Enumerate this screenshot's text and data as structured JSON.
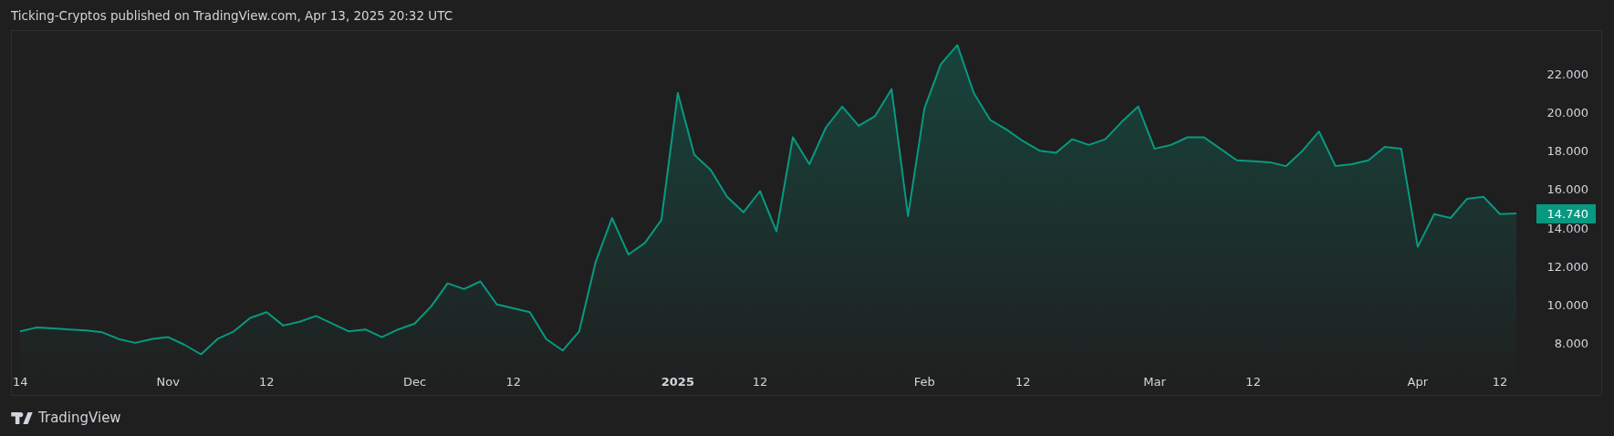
{
  "header": "Ticking-Cryptos published on TradingView.com, Apr 13, 2025 20:32 UTC",
  "chart": {
    "last_price": "14.740",
    "chart_data": {
      "type": "area",
      "categories": [
        "14",
        null,
        null,
        null,
        null,
        null,
        null,
        null,
        null,
        "Nov",
        null,
        null,
        null,
        null,
        null,
        "12",
        null,
        null,
        null,
        null,
        null,
        null,
        null,
        null,
        "Dec",
        null,
        null,
        null,
        null,
        null,
        "12",
        null,
        null,
        null,
        null,
        null,
        null,
        null,
        null,
        null,
        "**2025**",
        null,
        null,
        null,
        null,
        "12",
        null,
        null,
        null,
        null,
        null,
        null,
        null,
        null,
        null,
        "Feb",
        null,
        null,
        null,
        null,
        null,
        "12",
        null,
        null,
        null,
        null,
        null,
        null,
        null,
        "Mar",
        null,
        null,
        null,
        null,
        null,
        "12",
        null,
        null,
        null,
        null,
        null,
        null,
        null,
        null,
        null,
        "Apr",
        null,
        null,
        null,
        null,
        "12",
        null
      ],
      "series": [
        {
          "color": "#089981",
          "values": [
            8.6,
            8.8,
            8.75,
            8.7,
            8.65,
            8.55,
            8.2,
            8.0,
            8.2,
            8.3,
            7.9,
            7.4,
            8.2,
            8.6,
            9.3,
            9.6,
            8.9,
            9.1,
            9.4,
            9.0,
            8.6,
            8.7,
            8.3,
            8.7,
            9.0,
            9.9,
            11.1,
            10.8,
            11.2,
            10.0,
            9.8,
            9.6,
            8.2,
            7.6,
            8.6,
            12.2,
            14.5,
            12.6,
            13.2,
            14.4,
            21.0,
            17.8,
            17.0,
            15.6,
            14.8,
            15.9,
            13.8,
            18.7,
            17.3,
            19.2,
            20.3,
            19.3,
            19.8,
            21.2,
            14.6,
            20.2,
            22.5,
            23.5,
            21.0,
            19.6,
            19.1,
            18.5,
            18.0,
            17.9,
            18.6,
            18.3,
            18.6,
            19.5,
            20.3,
            18.1,
            18.3,
            18.7,
            18.7,
            18.1,
            17.5,
            17.45,
            17.4,
            17.2,
            18.0,
            19.0,
            17.2,
            17.3,
            17.5,
            18.2,
            18.1,
            13.0,
            14.7,
            14.5,
            15.5,
            15.6,
            14.7,
            14.74
          ]
        }
      ],
      "ylim": [
        5.29,
        24.23
      ],
      "yticks": [
        {
          "value": 8,
          "label": "8.000"
        },
        {
          "value": 10,
          "label": "10.000"
        },
        {
          "value": 12,
          "label": "12.000"
        },
        {
          "value": 14,
          "label": "14.000"
        },
        {
          "value": 16,
          "label": "16.000"
        },
        {
          "value": 18,
          "label": "18.000"
        },
        {
          "value": 20,
          "label": "20.000"
        },
        {
          "value": 22,
          "label": "22.000"
        }
      ]
    }
  },
  "footer": {
    "brand": "TradingView"
  }
}
